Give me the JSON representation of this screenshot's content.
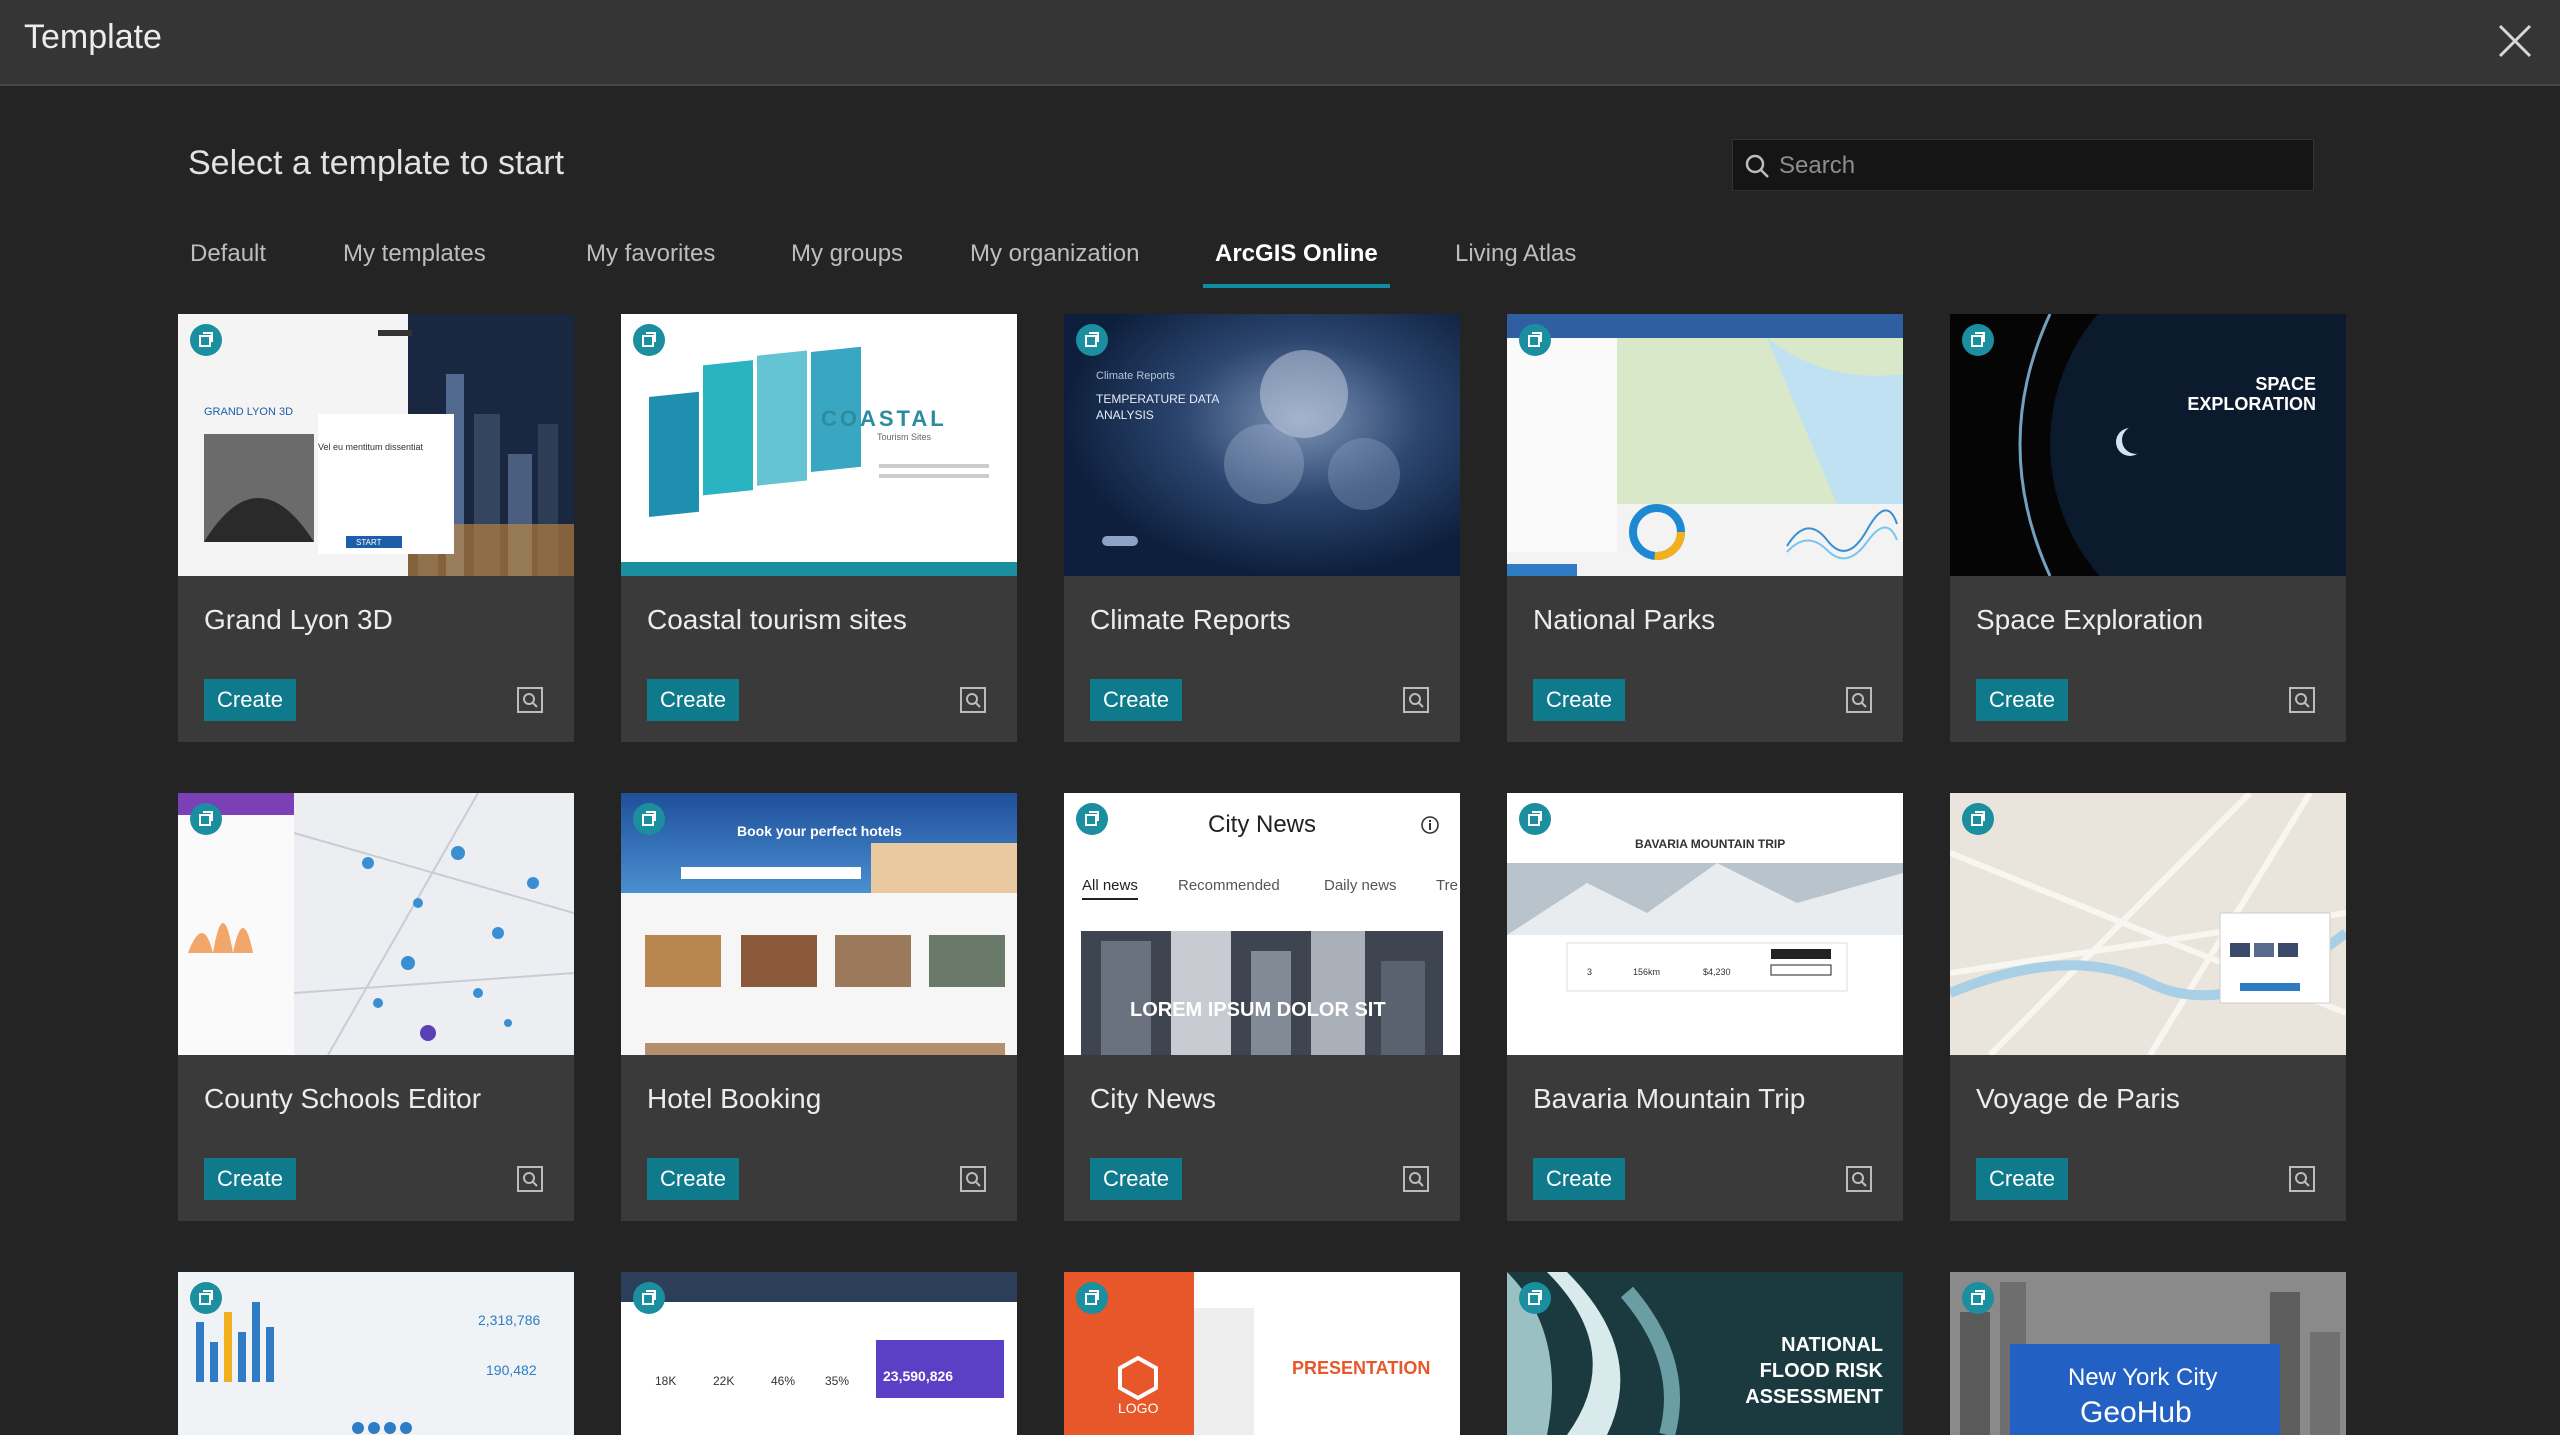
{
  "window": {
    "title": "Template"
  },
  "header": {
    "heading": "Select a template to start"
  },
  "search": {
    "placeholder": "Search",
    "value": ""
  },
  "tabs": [
    {
      "label": "Default"
    },
    {
      "label": "My templates"
    },
    {
      "label": "My favorites"
    },
    {
      "label": "My groups"
    },
    {
      "label": "My organization"
    },
    {
      "label": "ArcGIS Online",
      "active": true
    },
    {
      "label": "Living Atlas"
    }
  ],
  "cards": [
    {
      "title": "Grand Lyon 3D",
      "create_label": "Create",
      "thumb_text": [
        "GRAND LYON 3D",
        "Vel eu mentitum dissentiat",
        "START"
      ]
    },
    {
      "title": "Coastal tourism sites",
      "create_label": "Create",
      "thumb_text": [
        "COASTAL",
        "Tourism Sites"
      ]
    },
    {
      "title": "Climate Reports",
      "create_label": "Create",
      "thumb_text": [
        "Climate Reports",
        "TEMPERATURE DATA",
        "ANALYSIS"
      ]
    },
    {
      "title": "National Parks",
      "create_label": "Create",
      "thumb_text": []
    },
    {
      "title": "Space Exploration",
      "create_label": "Create",
      "thumb_text": [
        "SPACE",
        "EXPLORATION"
      ]
    },
    {
      "title": "County Schools Editor",
      "create_label": "Create",
      "thumb_text": []
    },
    {
      "title": "Hotel Booking",
      "create_label": "Create",
      "thumb_text": [
        "Book your perfect hotels"
      ]
    },
    {
      "title": "City News",
      "create_label": "Create",
      "thumb_text": [
        "City News",
        "All news",
        "Recommended",
        "Daily news",
        "Tre",
        "LOREM IPSUM DOLOR SIT"
      ]
    },
    {
      "title": "Bavaria Mountain Trip",
      "create_label": "Create",
      "thumb_text": [
        "BAVARIA MOUNTAIN TRIP",
        "3",
        "156km",
        "$4,230"
      ]
    },
    {
      "title": "Voyage de Paris",
      "create_label": "Create",
      "thumb_text": []
    },
    {
      "title": "",
      "create_label": "",
      "thumb_text": [
        "2,318,786",
        "190,482"
      ]
    },
    {
      "title": "",
      "create_label": "",
      "thumb_text": [
        "18K",
        "22K",
        "46%",
        "35%",
        "23,590,826"
      ]
    },
    {
      "title": "",
      "create_label": "",
      "thumb_text": [
        "PRESENTATION",
        "LOGO"
      ]
    },
    {
      "title": "",
      "create_label": "",
      "thumb_text": [
        "NATIONAL",
        "FLOOD RISK",
        "ASSESSMENT"
      ]
    },
    {
      "title": "",
      "create_label": "",
      "thumb_text": [
        "New York City",
        "GeoHub"
      ]
    }
  ],
  "icons": {
    "close": "close-icon",
    "search": "search-icon",
    "badge": "arcgis-template-badge-icon",
    "preview": "preview-magnifier-icon"
  },
  "colors": {
    "accent": "#0e7a8c",
    "badge": "#1b8ea0",
    "background": "#242424",
    "titlebar": "#353535",
    "card": "#3a3a3a"
  }
}
